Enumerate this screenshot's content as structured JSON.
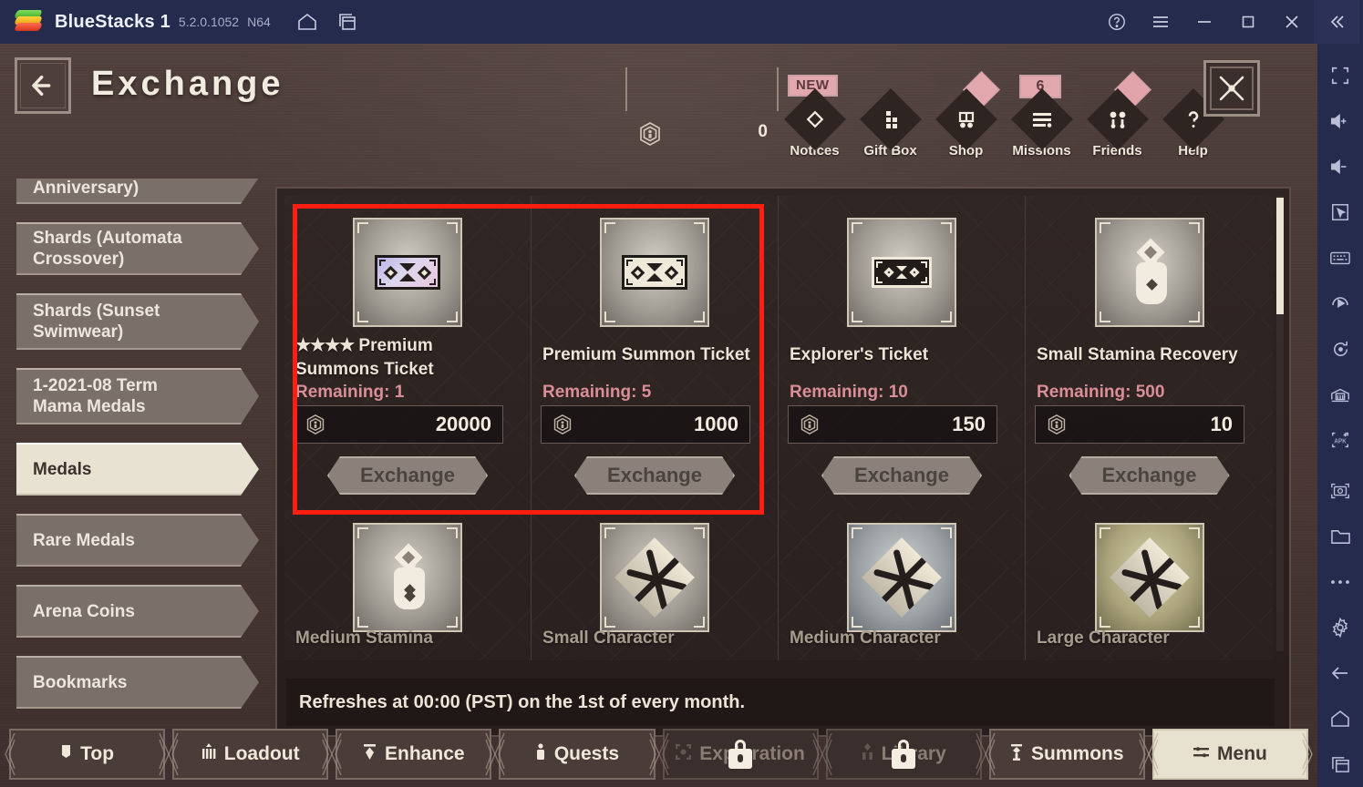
{
  "bluestacks": {
    "app_name": "BlueStacks 1",
    "version": "5.2.0.1052",
    "arch": "N64",
    "titlebar_icons": [
      "home-icon",
      "multi-instance-icon"
    ],
    "window_controls": [
      "help-icon",
      "hamburger-menu-icon",
      "minimize-icon",
      "maximize-icon",
      "close-icon",
      "collapse-sidebar-icon"
    ],
    "sidebar_icons": [
      "fullscreen-icon",
      "volume-up-icon",
      "volume-down-icon",
      "cursor-icon",
      "keyboard-controls-icon",
      "macro-recorder-icon",
      "rotate-icon",
      "multi-instance-manager-icon",
      "install-apk-icon",
      "screenshot-icon",
      "media-manager-icon",
      "more-options-icon",
      "settings-icon",
      "back-icon",
      "home-nav-icon",
      "recents-icon"
    ]
  },
  "game_header": {
    "back_button": "back-arrow-icon",
    "title": "Exchange",
    "currency_icon": "medal-hex-icon",
    "currency_value": "0",
    "close_button": "close-x-icon",
    "buttons": [
      {
        "label": "Notices",
        "icon": "diamond-icon",
        "badge": "NEW",
        "badge_type": "new"
      },
      {
        "label": "Gift Box",
        "icon": "gift-grid-icon",
        "badge": "",
        "badge_type": "none"
      },
      {
        "label": "Shop",
        "icon": "cart-icon",
        "badge": "",
        "badge_type": "dot"
      },
      {
        "label": "Missions",
        "icon": "list-icon",
        "badge": "6",
        "badge_type": "count"
      },
      {
        "label": "Friends",
        "icon": "friends-icon",
        "badge": "",
        "badge_type": "dot-hollow"
      },
      {
        "label": "Help",
        "icon": "question-icon",
        "badge": "",
        "badge_type": "none"
      }
    ]
  },
  "sidebar": {
    "items": [
      {
        "label": "Shard (Half-Year\nAnniversary)",
        "selected": false,
        "clipped_top": true
      },
      {
        "label": "Shards (Automata\nCrossover)",
        "selected": false
      },
      {
        "label": "Shards (Sunset\nSwimwear)",
        "selected": false
      },
      {
        "label": "1-2021-08 Term\nMama Medals",
        "selected": false
      },
      {
        "label": "Medals",
        "selected": true
      },
      {
        "label": "Rare Medals",
        "selected": false
      },
      {
        "label": "Arena Coins",
        "selected": false
      },
      {
        "label": "Bookmarks",
        "selected": false
      }
    ]
  },
  "exchange": {
    "items_row1": [
      {
        "stars": "★★★★",
        "name": "Premium\nSummons Ticket",
        "remaining_label": "Remaining: 1",
        "cost": "20000",
        "cost_icon": "medal-hex-icon",
        "button": "Exchange",
        "icon": "ticket-purple-icon",
        "highlighted": true
      },
      {
        "stars": "",
        "name": "Premium Summon Ticket",
        "remaining_label": "Remaining: 5",
        "cost": "1000",
        "cost_icon": "medal-hex-icon",
        "button": "Exchange",
        "icon": "ticket-cream-icon",
        "highlighted": true
      },
      {
        "stars": "",
        "name": "Explorer's Ticket",
        "remaining_label": "Remaining: 10",
        "cost": "150",
        "cost_icon": "medal-hex-icon",
        "button": "Exchange",
        "icon": "ticket-dark-icon",
        "highlighted": false
      },
      {
        "stars": "",
        "name": "Small Stamina Recovery",
        "remaining_label": "Remaining: 500",
        "cost": "10",
        "cost_icon": "medal-hex-icon",
        "button": "Exchange",
        "icon": "stamina-potion-icon",
        "highlighted": false
      }
    ],
    "items_row2": [
      {
        "name": "Medium Stamina",
        "icon": "stamina-potion-icon",
        "frame": "silver"
      },
      {
        "name": "Small Character",
        "icon": "character-swirl-icon",
        "frame": "silver"
      },
      {
        "name": "Medium Character",
        "icon": "character-swirl-icon",
        "frame": "blue"
      },
      {
        "name": "Large Character",
        "icon": "character-swirl-icon",
        "frame": "gold"
      }
    ],
    "footnote": "Refreshes at 00:00 (PST) on the 1st of every month."
  },
  "bottom_nav": [
    {
      "label": "Top",
      "icon": "top-icon",
      "state": "normal"
    },
    {
      "label": "Loadout",
      "icon": "loadout-icon",
      "state": "normal"
    },
    {
      "label": "Enhance",
      "icon": "enhance-icon",
      "state": "normal"
    },
    {
      "label": "Quests",
      "icon": "quests-icon",
      "state": "normal"
    },
    {
      "label": "Exploration",
      "icon": "exploration-icon",
      "state": "locked"
    },
    {
      "label": "Library",
      "icon": "library-icon",
      "state": "locked"
    },
    {
      "label": "Summons",
      "icon": "summons-icon",
      "state": "normal"
    },
    {
      "label": "Menu",
      "icon": "menu-icon",
      "state": "active"
    }
  ],
  "colors": {
    "highlight_red": "#ff1f12",
    "accent_pink": "#e3a8ae",
    "remaining_pink": "#d98e98",
    "cream": "#ece4d6",
    "bluestacks_navy": "#252b4d"
  }
}
